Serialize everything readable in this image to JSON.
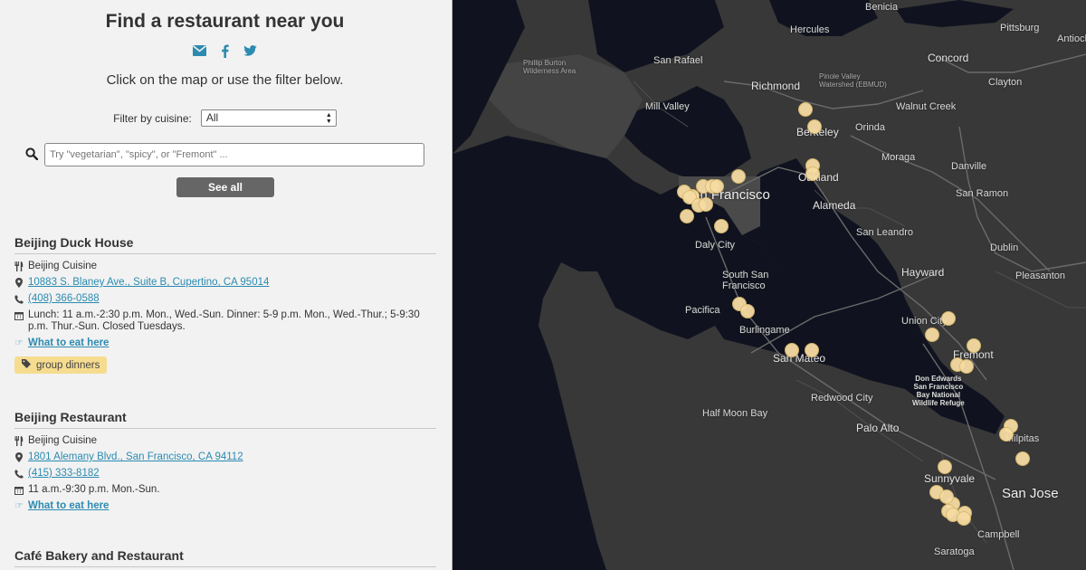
{
  "header": {
    "title": "Find a restaurant near you",
    "instructions": "Click on the map or use the filter below."
  },
  "social": [
    {
      "icon": "email-icon"
    },
    {
      "icon": "facebook-icon"
    },
    {
      "icon": "twitter-icon"
    }
  ],
  "filter": {
    "label": "Filter by cuisine:",
    "selected": "All"
  },
  "search": {
    "placeholder": "Try \"vegetarian\", \"spicy\", or \"Fremont\" ..."
  },
  "see_all_label": "See all",
  "restaurants": [
    {
      "name": "Beijing Duck House",
      "cuisine": "Beijing Cuisine",
      "address": "10883 S. Blaney Ave., Suite B, Cupertino, CA 95014",
      "phone": "(408) 366-0588",
      "hours": "Lunch: 11 a.m.-2:30 p.m. Mon., Wed.-Sun. Dinner: 5-9 p.m. Mon., Wed.-Thur.; 5-9:30 p.m. Thur.-Sun. Closed Tuesdays.",
      "what_to_eat": "What to eat here",
      "tag": "group dinners"
    },
    {
      "name": "Beijing Restaurant",
      "cuisine": "Beijing Cuisine",
      "address": "1801 Alemany Blvd., San Francisco, CA 94112",
      "phone": "(415) 333-8182",
      "hours": "11 a.m.-9:30 p.m. Mon.-Sun.",
      "what_to_eat": "What to eat here"
    },
    {
      "name": "Café Bakery and Restaurant"
    }
  ],
  "map": {
    "colors": {
      "land": "#383838",
      "water": "#10131f",
      "marker": "#f6dca3"
    },
    "labels": {
      "benicia": "Benicia",
      "hercules": "Hercules",
      "pittsburg": "Pittsburg",
      "antioch": "Antioch",
      "philip_burton": "Phillip Burton\nWilderness Area",
      "san_rafael": "San Rafael",
      "pinole": "Pinole Valley\nWatershed (EBMUD)",
      "concord": "Concord",
      "richmond": "Richmond",
      "clayton": "Clayton",
      "mill_valley": "Mill Valley",
      "walnut_creek": "Walnut Creek",
      "berkeley": "Berkeley",
      "orinda": "Orinda",
      "moraga": "Moraga",
      "danville": "Danville",
      "oakland": "Oakland",
      "san_francisco": "San Francisco",
      "alameda": "Alameda",
      "san_ramon": "San Ramon",
      "daly_city": "Daly City",
      "san_leandro": "San Leandro",
      "dublin": "Dublin",
      "hayward": "Hayward",
      "pleasanton": "Pleasanton",
      "south_sf": "South San\nFrancisco",
      "pacifica": "Pacifica",
      "union_city": "Union City",
      "burlingame": "Burlingame",
      "fremont": "Fremont",
      "san_mateo": "San Mateo",
      "don_edwards": "Don Edwards\nSan Francisco\nBay National\nWildlife Refuge",
      "redwood_city": "Redwood City",
      "half_moon_bay": "Half Moon Bay",
      "palo_alto": "Palo Alto",
      "milpitas": "Milpitas",
      "sunnyvale": "Sunnyvale",
      "san_jose": "San Jose",
      "campbell": "Campbell",
      "saratoga": "Saratoga"
    },
    "marker_count": 35
  }
}
